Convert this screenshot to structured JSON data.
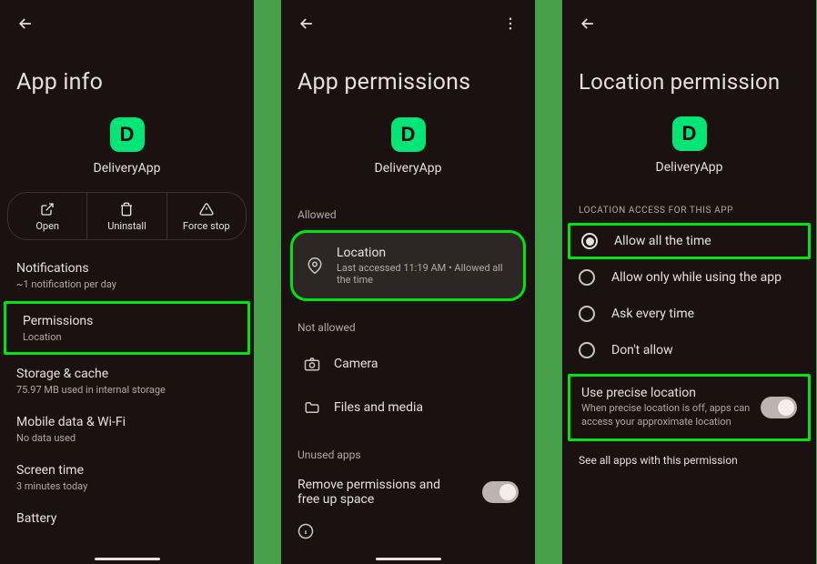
{
  "app": {
    "name": "DeliveryApp",
    "icon_letter": "D"
  },
  "screen1": {
    "title": "App info",
    "actions": {
      "open": "Open",
      "uninstall": "Uninstall",
      "forcestop": "Force stop"
    },
    "items": [
      {
        "title": "Notifications",
        "sub": "~1 notification per day"
      },
      {
        "title": "Permissions",
        "sub": "Location"
      },
      {
        "title": "Storage & cache",
        "sub": "75.97 MB used in internal storage"
      },
      {
        "title": "Mobile data & Wi-Fi",
        "sub": "No data used"
      },
      {
        "title": "Screen time",
        "sub": "3 minutes today"
      },
      {
        "title": "Battery",
        "sub": ""
      }
    ]
  },
  "screen2": {
    "title": "App permissions",
    "allowed_label": "Allowed",
    "not_allowed_label": "Not allowed",
    "allowed": [
      {
        "title": "Location",
        "sub": "Last accessed 11:19 AM • Allowed all the time"
      }
    ],
    "not_allowed": [
      {
        "title": "Camera"
      },
      {
        "title": "Files and media"
      }
    ],
    "unused_label": "Unused apps",
    "remove_label": "Remove permissions and free up space"
  },
  "screen3": {
    "title": "Location permission",
    "section": "Location access for this app",
    "options": [
      "Allow all the time",
      "Allow only while using the app",
      "Ask every time",
      "Don't allow"
    ],
    "precise": {
      "title": "Use precise location",
      "sub": "When precise location is off, apps can access your approximate location"
    },
    "see_all": "See all apps with this permission"
  }
}
